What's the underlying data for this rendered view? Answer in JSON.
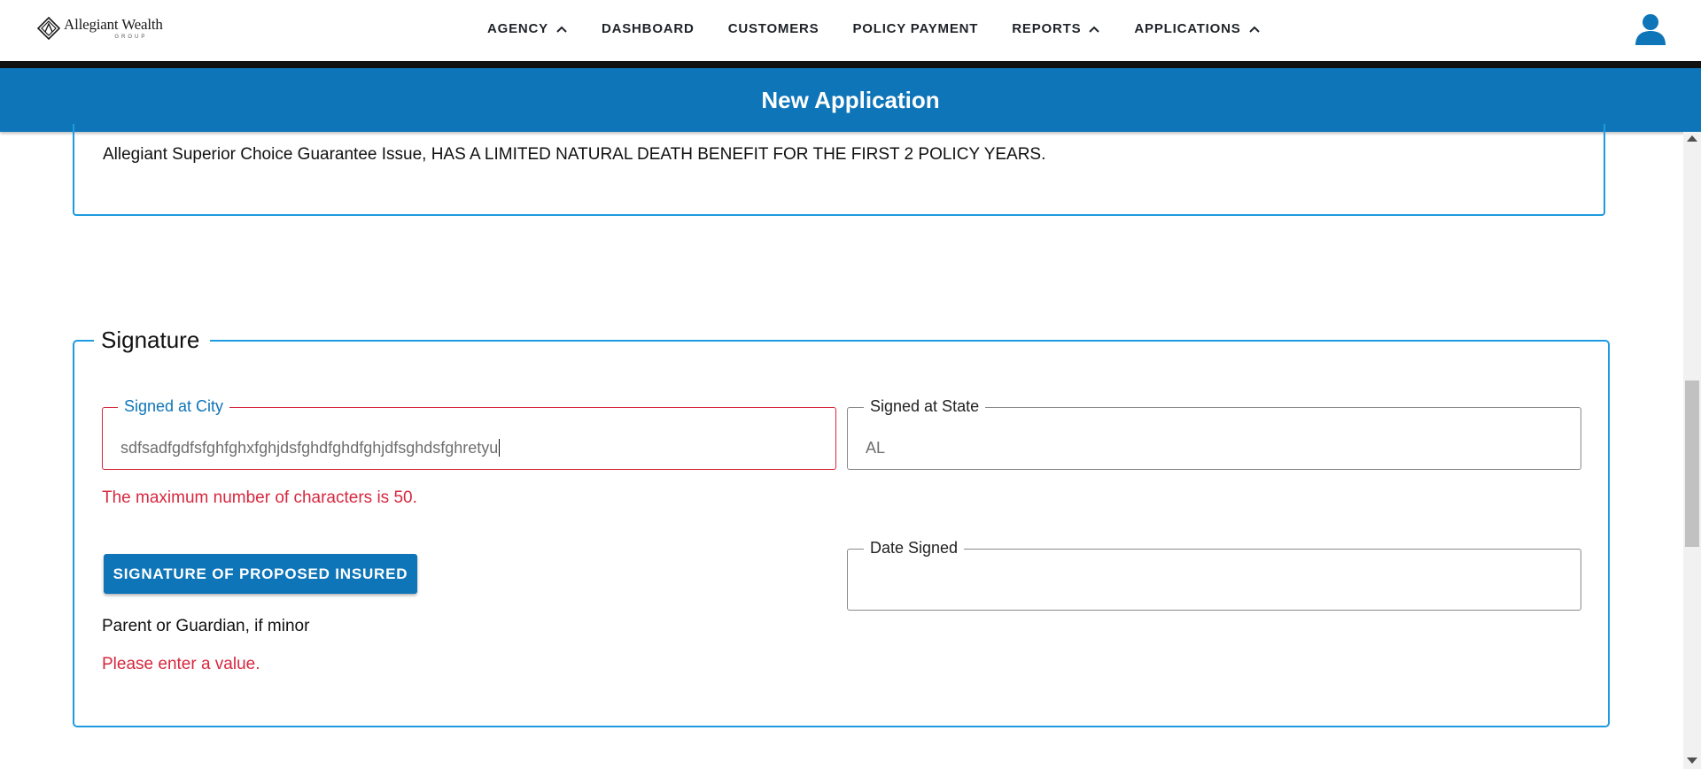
{
  "nav": {
    "logo_name": "Allegiant Wealth",
    "logo_sub": "GROUP",
    "items": [
      {
        "label": "AGENCY",
        "has_chevron": true
      },
      {
        "label": "DASHBOARD",
        "has_chevron": false
      },
      {
        "label": "CUSTOMERS",
        "has_chevron": false
      },
      {
        "label": "POLICY PAYMENT",
        "has_chevron": false
      },
      {
        "label": "REPORTS",
        "has_chevron": true
      },
      {
        "label": "APPLICATIONS",
        "has_chevron": true
      }
    ],
    "user_icon": "user-icon"
  },
  "header": {
    "title": "New Application"
  },
  "notice": {
    "text": "Allegiant Superior Choice Guarantee Issue, HAS A LIMITED NATURAL DEATH BENEFIT FOR THE FIRST 2 POLICY YEARS."
  },
  "signature": {
    "legend": "Signature",
    "city": {
      "label": "Signed at City",
      "value": "sdfsadfgdfsfghfghxfghjdsfghdfghdfghjdfsghdsfghretyu",
      "error": "The maximum number of characters is 50."
    },
    "state": {
      "label": "Signed at State",
      "value": "AL"
    },
    "date": {
      "label": "Date Signed",
      "value": ""
    },
    "button_label": "SIGNATURE OF PROPOSED INSURED",
    "guardian_text": "Parent or Guardian, if minor",
    "signature_error": "Please enter a value."
  },
  "colors": {
    "brand_blue": "#0e75b8",
    "border_blue": "#1e9be0",
    "error_red": "#d6283f"
  }
}
